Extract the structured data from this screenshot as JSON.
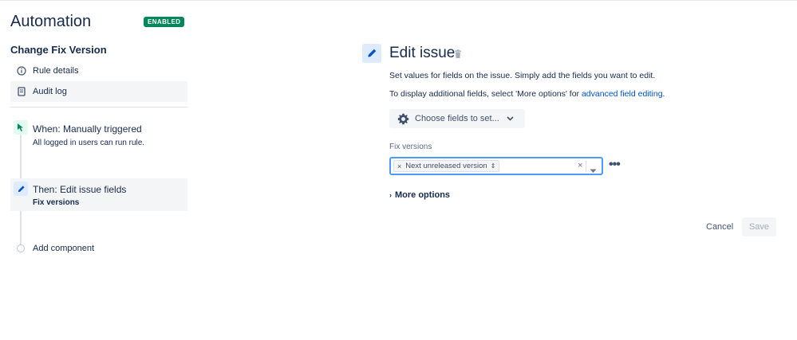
{
  "sidebar": {
    "app_title": "Automation",
    "status_badge": "ENABLED",
    "rule_name": "Change Fix Version",
    "nav": [
      {
        "label": "Rule details",
        "icon": "info-icon"
      },
      {
        "label": "Audit log",
        "icon": "document-icon"
      }
    ],
    "steps": {
      "when": {
        "title": "When: Manually triggered",
        "subtitle": "All logged in users can run rule.",
        "icon": "cursor-click-icon"
      },
      "then": {
        "title": "Then: Edit issue fields",
        "subtitle": "Fix versions",
        "icon": "pencil-icon"
      }
    },
    "add_component": "Add component"
  },
  "main": {
    "title": "Edit issue",
    "description_line1": "Set values for fields on the issue. Simply add the fields you want to edit.",
    "description_line2_prefix": "To display additional fields, select 'More options' for ",
    "description_line2_link": "advanced field editing",
    "description_line2_suffix": ".",
    "choose_fields_label": "Choose fields to set...",
    "field": {
      "label": "Fix versions",
      "selected_values": [
        "Next unreleased version"
      ],
      "tag_remove_glyph": "×",
      "tag_updown_glyph": "⇕",
      "clear_glyph": "×"
    },
    "more_options_label": "More options",
    "more_actions_glyph": "•••",
    "cancel_label": "Cancel",
    "save_label": "Save"
  },
  "colors": {
    "accent": "#0052cc",
    "badge": "#00875a",
    "focus_border": "#4c9aff",
    "text": "#172b4d"
  }
}
